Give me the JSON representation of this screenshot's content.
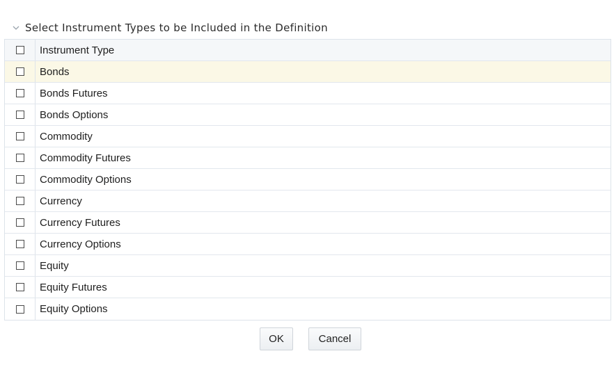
{
  "section": {
    "title": "Select Instrument Types to be Included in the Definition",
    "icon": "chevron-down-icon"
  },
  "table": {
    "header": "Instrument Type",
    "rows": [
      "Bonds",
      "Bonds Futures",
      "Bonds Options",
      "Commodity",
      "Commodity Futures",
      "Commodity Options",
      "Currency",
      "Currency Futures",
      "Currency Options",
      "Equity",
      "Equity Futures",
      "Equity Options"
    ],
    "selected_row_color": "#fbf8e6"
  },
  "buttons": {
    "ok": "OK",
    "cancel": "Cancel"
  }
}
